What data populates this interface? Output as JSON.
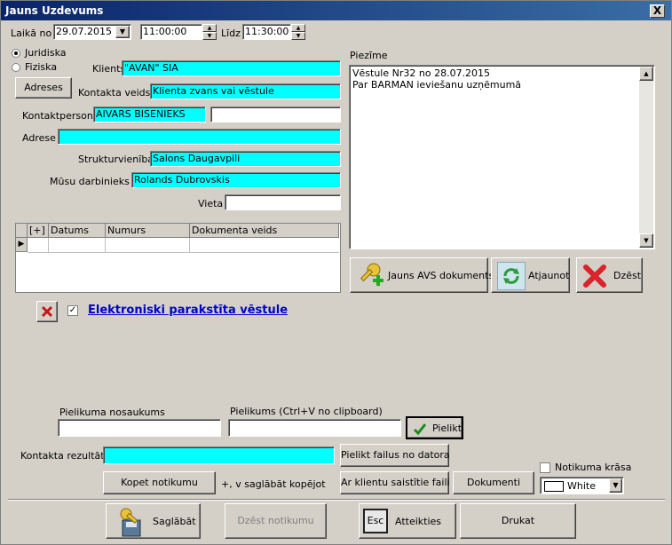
{
  "window": {
    "title": "Jauns Uzdevums",
    "close_glyph": "X"
  },
  "time": {
    "from_label": "Laikā no",
    "date": "29.07.2015",
    "start": "11:00:00",
    "to_label": "Līdz",
    "end": "11:30:00"
  },
  "client_type": {
    "option1": "Juridiska",
    "option2": "Fiziska",
    "selected": "Juridiska"
  },
  "form": {
    "client_label": "Klients",
    "client": "\"AVAN\" SIA",
    "addresses_button": "Adreses",
    "contact_type_label": "Kontakta veids",
    "contact_type": "Klienta zvans vai vēstule",
    "contact_person_label": "Kontaktpersona",
    "contact_person": "AIVARS BISENIEKS",
    "contact_person_extra": "",
    "address_label": "Adrese",
    "address": "",
    "unit_label": "Strukturvienība",
    "unit": "Salons Daugavpili",
    "employee_label": "Mūsu darbinieks",
    "employee": "Rolands Dubrovskis",
    "place_label": "Vieta",
    "place": ""
  },
  "docs_table": {
    "columns": [
      "[+]",
      "Datums",
      "Numurs",
      "Dokumenta veids"
    ]
  },
  "note": {
    "label": "Piezīme",
    "lines": [
      "Vēstule Nr32 no 28.07.2015",
      "Par BARMAN ieviešanu uzņēmumā"
    ]
  },
  "note_buttons": {
    "new_doc": "Jauns AVS dokuments",
    "refresh": "Atjaunot",
    "delete": "Dzēst"
  },
  "esigned": {
    "label": "Elektroniski parakstīta vēstule",
    "checked": true,
    "check_glyph": "✓"
  },
  "attachment": {
    "name_label": "Pielikuma nosaukums",
    "name": "",
    "file_label": "Pielikums (Ctrl+V no clipboard)",
    "file": "",
    "attach_button": "Pielikt"
  },
  "result": {
    "label": "Kontakta rezultāts",
    "value": "",
    "attach_from_pc": "Pielikt failus no datora",
    "copy_event": "Kopet notikumu",
    "copy_hint": "+, v saglābāt kopējot",
    "client_files": "Ar klientu saistītie faili",
    "documents": "Dokumenti",
    "event_color_label": "Notikuma krāsa",
    "event_color": "White"
  },
  "footer": {
    "save": "Saglābāt",
    "delete_event": "Dzēst notikumu",
    "cancel": "Atteikties",
    "print": "Drukat",
    "esc_key": "Esc"
  }
}
